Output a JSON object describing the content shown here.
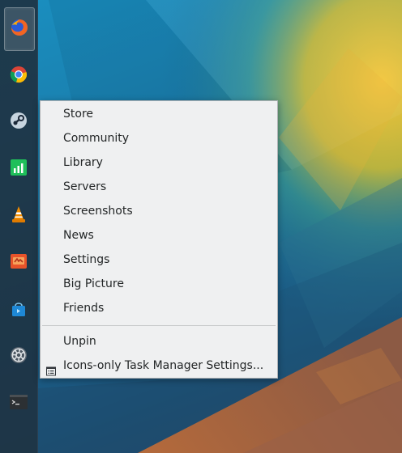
{
  "colors": {
    "panel": "#1e3444",
    "menu_bg": "#eff0f1",
    "menu_text": "#232627",
    "separator": "#c7c9cb"
  },
  "taskbar": {
    "tasks": [
      {
        "icon": "firefox-icon",
        "active": true
      },
      {
        "icon": "chrome-icon",
        "active": false
      },
      {
        "icon": "steam-icon",
        "active": false
      },
      {
        "icon": "spreadsheet-icon",
        "active": false
      },
      {
        "icon": "vlc-icon",
        "active": false
      },
      {
        "icon": "orange-app-icon",
        "active": false
      },
      {
        "icon": "store-bag-icon",
        "active": false
      },
      {
        "icon": "settings-icon",
        "active": false
      },
      {
        "icon": "terminal-icon",
        "active": false
      }
    ]
  },
  "context_menu": {
    "items": [
      "Store",
      "Community",
      "Library",
      "Servers",
      "Screenshots",
      "News",
      "Settings",
      "Big Picture",
      "Friends"
    ],
    "unpin": "Unpin",
    "task_manager_settings": "Icons-only Task Manager Settings...",
    "task_manager_settings_icon": "configure-icon"
  }
}
